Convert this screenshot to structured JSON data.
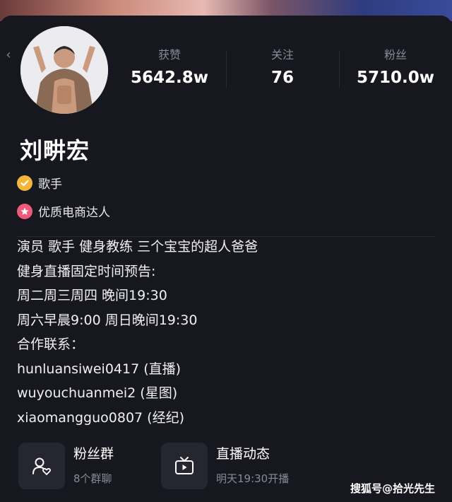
{
  "profile": {
    "name": "刘畊宏",
    "tags": [
      {
        "icon": "verified-check-icon",
        "label": "歌手",
        "color": "#f4b63a"
      },
      {
        "icon": "star-badge-icon",
        "label": "优质电商达人",
        "color": "#f05a7a"
      }
    ]
  },
  "stats": [
    {
      "label": "获赞",
      "value": "5642.8w"
    },
    {
      "label": "关注",
      "value": "76"
    },
    {
      "label": "粉丝",
      "value": "5710.0w"
    }
  ],
  "bio": [
    "演员 歌手 健身教练 三个宝宝的超人爸爸",
    "健身直播固定时间预告:",
    "周二周三周四 晚间19:30",
    "周六早晨9:00 周日晚间19:30",
    "合作联系：",
    "hunluansiwei0417 (直播)",
    "wuyouchuanmei2 (星图)",
    "xiaomangguo0807 (经纪)"
  ],
  "features": [
    {
      "icon": "fans-group-icon",
      "title": "粉丝群",
      "sub": "8个群聊"
    },
    {
      "icon": "live-tv-icon",
      "title": "直播动态",
      "sub": "明天19:30开播"
    }
  ],
  "watermark": "搜狐号@拾光先生"
}
